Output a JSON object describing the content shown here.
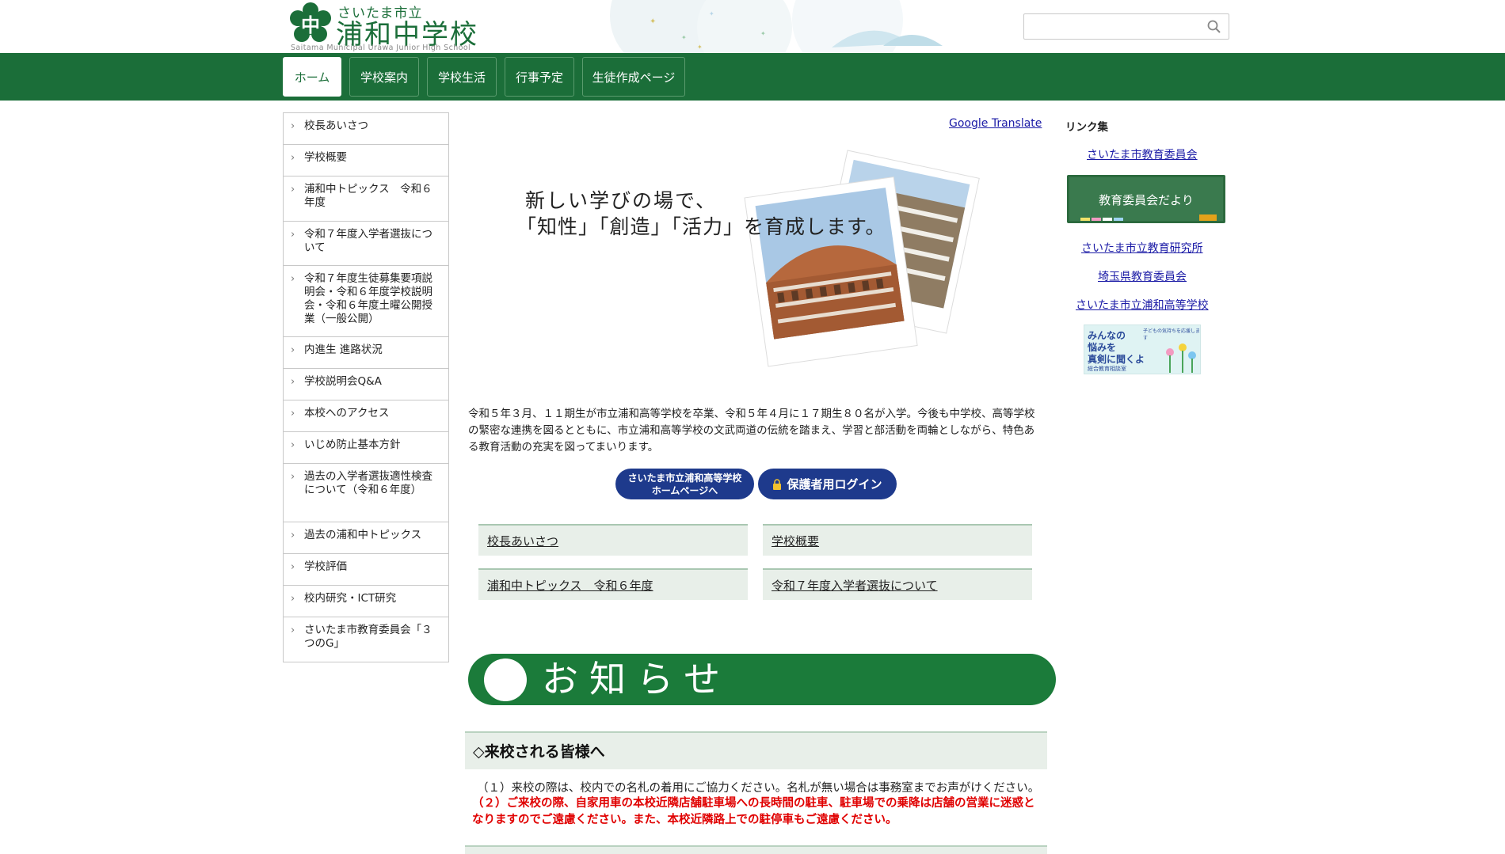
{
  "header": {
    "logo_small": "さいたま市立",
    "logo_big": "浦和中学校",
    "logo_en": "Saitama Municipal Urawa Junior High School",
    "logo_mark": "中",
    "search_placeholder": ""
  },
  "nav": {
    "tabs": [
      {
        "label": "ホーム",
        "active": true
      },
      {
        "label": "学校案内"
      },
      {
        "label": "学校生活"
      },
      {
        "label": "行事予定"
      },
      {
        "label": "生徒作成ページ"
      }
    ]
  },
  "sidebar": {
    "items": [
      "校長あいさつ",
      "学校概要",
      "浦和中トピックス　令和６年度",
      "令和７年度入学者選抜について",
      "令和７年度生徒募集要項説明会・令和６年度学校説明会・令和６年度土曜公開授業（一般公開）",
      "内進生 進路状況",
      "学校説明会Q&A",
      "本校へのアクセス",
      "いじめ防止基本方針",
      "過去の入学者選抜適性検査について（令和６年度）",
      "過去の浦和中トピックス",
      "学校評価",
      "校内研究・ICT研究",
      "さいたま市教育委員会「３つのG」"
    ]
  },
  "main": {
    "translate": "Google Translate",
    "hero_line1": "新しい学びの場で、",
    "hero_line2": "「知性」「創造」「活力」を育成します。",
    "intro": "令和５年３月、１１期生が市立浦和高等学校を卒業、令和５年４月に１７期生８０名が入学。今後も中学校、高等学校の緊密な連携を図るとともに、市立浦和高等学校の文武両道の伝統を踏まえ、学習と部活動を両輪としながら、特色ある教育活動の充実を図ってまいります。",
    "pill_hs": "さいたま市立浦和高等学校\nホームページへ",
    "pill_hs_1": "さいたま市立浦和高等学校",
    "pill_hs_2": "ホームページへ",
    "pill_login": "保護者用ログイン",
    "quick_links": [
      "校長あいさつ",
      "学校概要",
      "浦和中トピックス　令和６年度",
      "令和７年度入学者選抜について"
    ],
    "notice_title": "お知らせ",
    "visit_heading": "◇来校される皆様へ",
    "visit_line1": "（１）来校の際は、校内での名札の着用にご協力ください。名札が無い場合は事務室までお声がけください。",
    "visit_line2": "（２）ご来校の際、自家用車の本校近隣店舗駐車場への長時間の駐車、駐車場での乗降は店舗の営業に迷惑となりますのでご遠慮ください。また、本校近隣路上での駐停車もご遠慮ください。"
  },
  "right": {
    "title": "リンク集",
    "link1": "さいたま市教育委員会",
    "board_news": "教育委員会だより",
    "link2": "さいたま市立教育研究所",
    "link3": "埼玉県教育委員会",
    "link4": "さいたま市立浦和高等学校",
    "worry_1": "みんなの",
    "worry_2": "悩みを",
    "worry_3": "真剣に聞くよ",
    "worry_top": "子どもの気持ちを応援します",
    "worry_bottom": "総合教育相談室"
  },
  "colors": {
    "brand_green": "#1b6e39",
    "notice_green": "#1b7b3a",
    "pill_blue": "#1e3a8c",
    "warning_red": "#e00000"
  },
  "icons": [
    "search-icon",
    "chevron-right-icon",
    "lock-icon",
    "school-logo-icon"
  ]
}
